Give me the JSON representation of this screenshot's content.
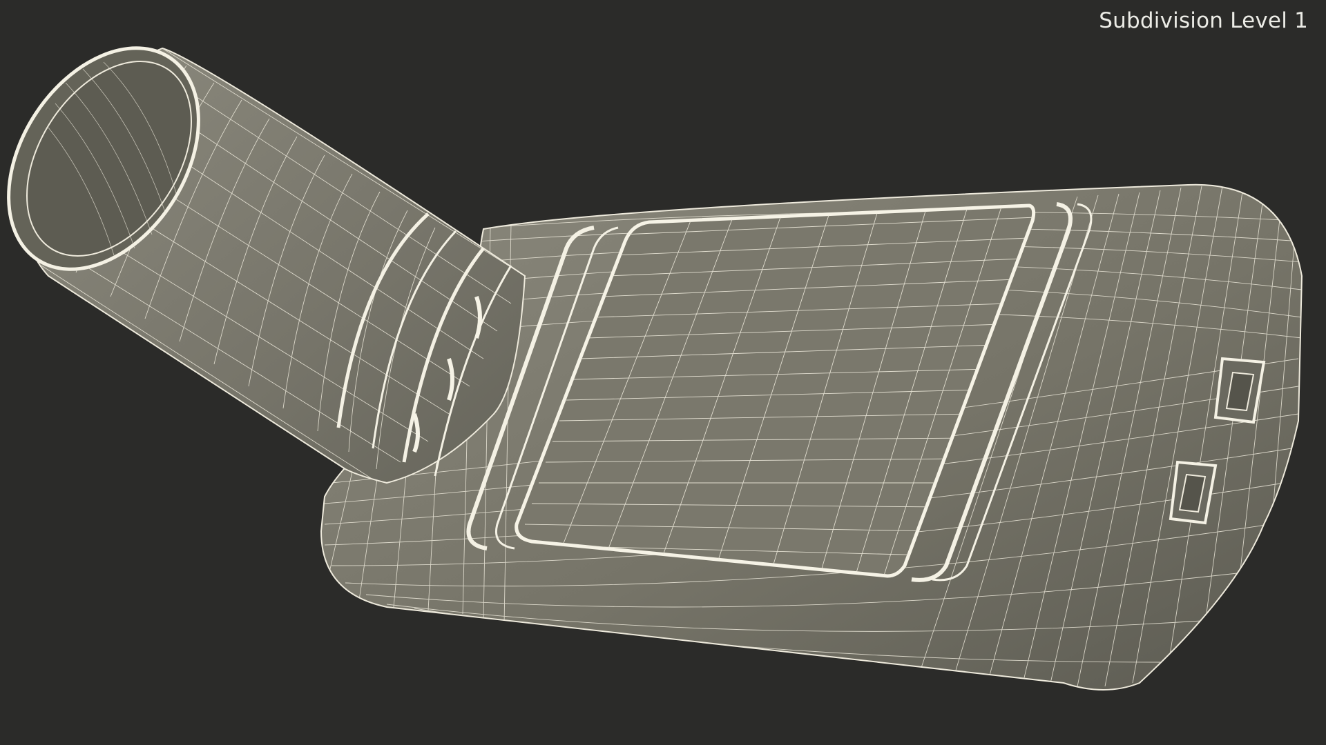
{
  "viewport": {
    "subdivision_label": "Subdivision Level 1",
    "object": "wireframe-spirometer-model"
  },
  "colors": {
    "background": "#2b2b29",
    "surface": "#7c7a6e",
    "wire": "#f2f0e2",
    "label": "#ecece6"
  }
}
